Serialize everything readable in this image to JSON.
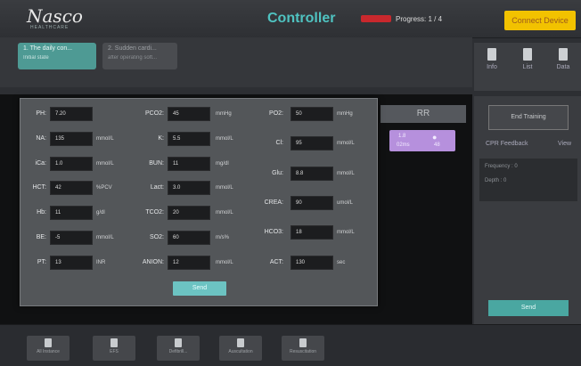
{
  "app": {
    "logo_text": "Nasco",
    "logo_sub": "HEALTHCARE",
    "title": "Controller",
    "progress": "Progress: 1 / 4",
    "connect_label": "Connect Device"
  },
  "tasks": [
    {
      "title": "1.  The daily con...",
      "sub": "Initial state"
    },
    {
      "title": "2.  Sudden cardi...",
      "sub": "after operating soft..."
    }
  ],
  "right_icons": [
    {
      "label": "Info",
      "icon": "info-icon"
    },
    {
      "label": "List",
      "icon": "list-icon"
    },
    {
      "label": "Data",
      "icon": "folder-icon"
    }
  ],
  "rr_label": "RR",
  "purple_tile": {
    "left_top": "1.8",
    "left_bottom": "02ms",
    "right_bottom": "48"
  },
  "side": {
    "end_training": "End Training",
    "cpr_feedback": "CPR Feedback",
    "view": "View",
    "frequency": "Frequency : 0",
    "depth": "Depth : 0",
    "send": "Send"
  },
  "lab": {
    "col1": [
      {
        "label": "PH:",
        "value": "7.20",
        "unit": ""
      },
      {
        "label": "NA:",
        "value": "135",
        "unit": "mmol/L"
      },
      {
        "label": "iCa:",
        "value": "1.0",
        "unit": "mmol/L"
      },
      {
        "label": "HCT:",
        "value": "42",
        "unit": "%PCV"
      },
      {
        "label": "Hb:",
        "value": "11",
        "unit": "g/dl"
      },
      {
        "label": "BE:",
        "value": "-5",
        "unit": "mmol/L"
      },
      {
        "label": "PT:",
        "value": "13",
        "unit": "INR"
      }
    ],
    "col2": [
      {
        "label": "PCO2:",
        "value": "45",
        "unit": "mmHg"
      },
      {
        "label": "K:",
        "value": "5.5",
        "unit": "mmol/L"
      },
      {
        "label": "BUN:",
        "value": "11",
        "unit": "mg/dl"
      },
      {
        "label": "Lact:",
        "value": "3.0",
        "unit": "mmol/L"
      },
      {
        "label": "TCO2:",
        "value": "20",
        "unit": "mmol/L"
      },
      {
        "label": "SO2:",
        "value": "60",
        "unit": "m/s%"
      },
      {
        "label": "ANION:",
        "value": "12",
        "unit": "mmol/L"
      }
    ],
    "col3": [
      {
        "label": "PO2:",
        "value": "50",
        "unit": "mmHg"
      },
      {
        "label": "Cl:",
        "value": "95",
        "unit": "mmol/L"
      },
      {
        "label": "Glu:",
        "value": "8.8",
        "unit": "mmol/L"
      },
      {
        "label": "CREA:",
        "value": "90",
        "unit": "umol/L"
      },
      {
        "label": "HCO3:",
        "value": "18",
        "unit": "mmol/L"
      },
      {
        "label": "ACT:",
        "value": "130",
        "unit": "sec"
      }
    ],
    "send": "Send"
  },
  "bottom": [
    {
      "label": "All Instance",
      "icon": "user-icon"
    },
    {
      "label": "EFS",
      "icon": "pen-icon"
    },
    {
      "label": "Defibrill...",
      "icon": "heart-icon"
    },
    {
      "label": "Auscultation",
      "icon": "stethoscope-icon"
    },
    {
      "label": "Resuscitation",
      "icon": "person-icon"
    }
  ]
}
